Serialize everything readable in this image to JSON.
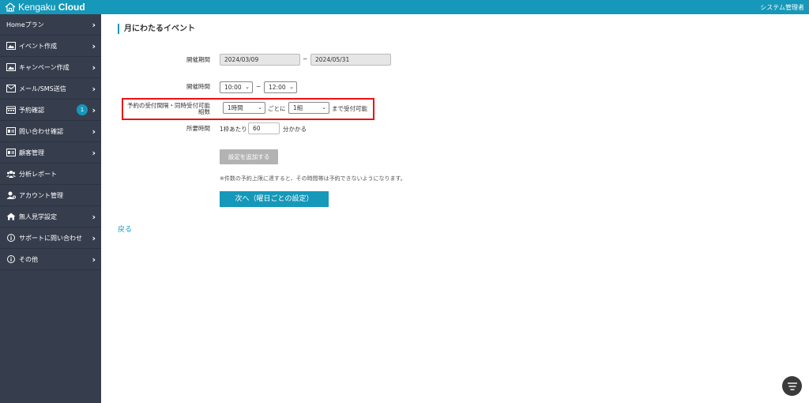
{
  "header": {
    "logo_prefix": "Kengaku",
    "logo_suffix": "Cloud",
    "admin_label": "システム管理者"
  },
  "sidebar": {
    "items": [
      {
        "label": "Homeプラン",
        "icon": "none",
        "has_chevron": true
      },
      {
        "label": "イベント作成",
        "icon": "image-icon",
        "has_chevron": true
      },
      {
        "label": "キャンペーン作成",
        "icon": "image-icon",
        "has_chevron": true
      },
      {
        "label": "メール/SMS送信",
        "icon": "mail-icon",
        "has_chevron": true
      },
      {
        "label": "予約確認",
        "icon": "calendar-icon",
        "has_chevron": true,
        "badge": "1"
      },
      {
        "label": "問い合わせ確認",
        "icon": "id-card-icon",
        "has_chevron": true
      },
      {
        "label": "顧客管理",
        "icon": "id-card-icon",
        "has_chevron": true
      },
      {
        "label": "分析レポート",
        "icon": "users-icon",
        "has_chevron": false
      },
      {
        "label": "アカウント管理",
        "icon": "user-gear-icon",
        "has_chevron": false
      },
      {
        "label": "無人見学設定",
        "icon": "home-icon",
        "has_chevron": true
      },
      {
        "label": "サポートに問い合わせ",
        "icon": "info-icon",
        "has_chevron": true
      },
      {
        "label": "その他",
        "icon": "info-icon",
        "has_chevron": true
      }
    ]
  },
  "main": {
    "title": "月にわたるイベント",
    "period": {
      "label": "開催期間",
      "start": "2024/03/09",
      "separator": "~",
      "end": "2024/05/31"
    },
    "time": {
      "label": "開催時間",
      "start": "10:00",
      "separator": "~",
      "end": "12:00"
    },
    "reservation": {
      "label_line1": "予約の受付間隔・同時受付可能",
      "label_line2": "組数",
      "interval": "1時間",
      "every_text": "ごとに",
      "groups": "1組",
      "suffix": "まで受付可能"
    },
    "duration": {
      "label": "所要時間",
      "prefix": "1枠あたり",
      "value": "60",
      "suffix": "分かかる"
    },
    "add_button": "設定を追加する",
    "note": "※件数の予約上限に達すると、その時間帯は予約できないようになります。",
    "next_button": "次へ（曜日ごとの設定）",
    "back_link": "戻る"
  },
  "colors": {
    "accent": "#1598b9",
    "sidebar_bg": "#363e4e",
    "highlight": "#ee1111"
  }
}
